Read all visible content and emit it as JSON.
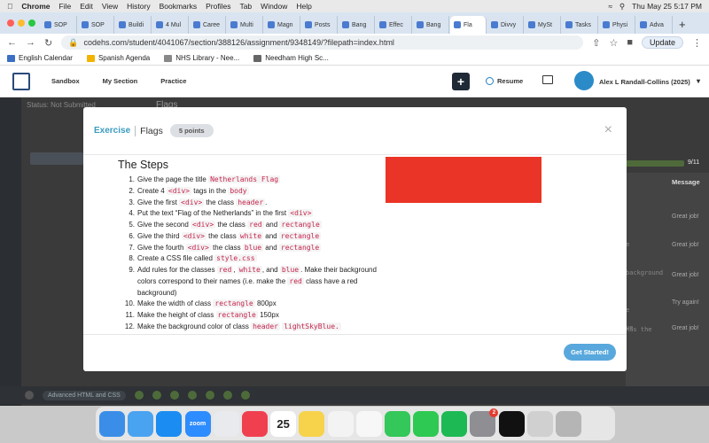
{
  "menubar": {
    "app": "Chrome",
    "items": [
      "File",
      "Edit",
      "View",
      "History",
      "Bookmarks",
      "Profiles",
      "Tab",
      "Window",
      "Help"
    ],
    "clock": "Thu May 25  5:17 PM"
  },
  "tabs": [
    "SOP",
    "SOP",
    "Buildi",
    "4 Mul",
    "Caree",
    "Multi",
    "Magn",
    "Posts",
    "Bang",
    "Effec",
    "Bang",
    "Fla",
    "Divvy",
    "MySt",
    "Tasks",
    "Physi",
    "Adva"
  ],
  "toolbar": {
    "url": "codehs.com/student/4041067/section/388126/assignment/9348149/?filepath=index.html",
    "update_label": "Update"
  },
  "bookmarks": [
    {
      "label": "English Calendar",
      "color": "#3b6fc4"
    },
    {
      "label": "Spanish Agenda",
      "color": "#f2b400"
    },
    {
      "label": "NHS Library - Nee...",
      "color": "#888888"
    },
    {
      "label": "Needham High Sc...",
      "color": "#666666"
    }
  ],
  "appheader": {
    "nav": [
      "Sandbox",
      "My Section",
      "Practice"
    ],
    "plus": "+",
    "resume": "Resume",
    "user": "Alex L Randall-Collins (2025)"
  },
  "ide": {
    "status": "Status: Not Submitted",
    "tab_text": "Flags",
    "progress_count": "9/11",
    "message_header": "Message",
    "messages": [
      "Great job!",
      "Great job!",
      "Great job!",
      "Try again!",
      "Great job!"
    ],
    "fragments": [
      "e",
      "background",
      "e",
      "ue",
      "has the"
    ],
    "footer_label": "Advanced HTML and CSS"
  },
  "modal": {
    "breadcrumb_exercise": "Exercise",
    "title": "Flags",
    "points": "5 points",
    "close": "×",
    "steps_title": "The Steps",
    "steps": [
      {
        "n": "1.",
        "parts": [
          {
            "t": "Give the page the title "
          },
          {
            "c": "Netherlands Flag"
          }
        ]
      },
      {
        "n": "2.",
        "parts": [
          {
            "t": "Create 4 "
          },
          {
            "c": "<div>"
          },
          {
            "t": " tags in the "
          },
          {
            "c": "body"
          }
        ]
      },
      {
        "n": "3.",
        "parts": [
          {
            "t": "Give the first "
          },
          {
            "c": "<div>"
          },
          {
            "t": " the class "
          },
          {
            "c": "header"
          },
          {
            "t": "."
          }
        ]
      },
      {
        "n": "4.",
        "parts": [
          {
            "t": "Put the text “Flag of the Netherlands” in the first "
          },
          {
            "c": "<div>"
          }
        ]
      },
      {
        "n": "5.",
        "parts": [
          {
            "t": "Give the second "
          },
          {
            "c": "<div>"
          },
          {
            "t": " the class "
          },
          {
            "c": "red"
          },
          {
            "t": " and "
          },
          {
            "c": "rectangle"
          }
        ]
      },
      {
        "n": "6.",
        "parts": [
          {
            "t": "Give the third "
          },
          {
            "c": "<div>"
          },
          {
            "t": " the class "
          },
          {
            "c": "white"
          },
          {
            "t": " and "
          },
          {
            "c": "rectangle"
          }
        ]
      },
      {
        "n": "7.",
        "parts": [
          {
            "t": "Give the fourth "
          },
          {
            "c": "<div>"
          },
          {
            "t": " the class "
          },
          {
            "c": "blue"
          },
          {
            "t": " and "
          },
          {
            "c": "rectangle"
          }
        ]
      },
      {
        "n": "8.",
        "parts": [
          {
            "t": "Create a CSS file called "
          },
          {
            "c": "style.css"
          }
        ]
      },
      {
        "n": "9.",
        "parts": [
          {
            "t": "Add rules for the classes "
          },
          {
            "c": "red"
          },
          {
            "t": ", "
          },
          {
            "c": "white"
          },
          {
            "t": ", and "
          },
          {
            "c": "blue"
          },
          {
            "t": ". Make their background colors correspond to their names (i.e. make the "
          },
          {
            "c": "red"
          },
          {
            "t": " class have a red background)"
          }
        ]
      },
      {
        "n": "10.",
        "parts": [
          {
            "t": "Make the width of class "
          },
          {
            "c": "rectangle"
          },
          {
            "t": " 800px"
          }
        ]
      },
      {
        "n": "11.",
        "parts": [
          {
            "t": "Make the height of class "
          },
          {
            "c": "rectangle"
          },
          {
            "t": " 150px"
          }
        ]
      },
      {
        "n": "12.",
        "parts": [
          {
            "t": "Make the background color of class "
          },
          {
            "c": "header"
          },
          {
            "t": " "
          },
          {
            "c": "lightSkyBlue."
          }
        ]
      }
    ],
    "preview_color": "#ea3427",
    "cta": "Get Started!"
  },
  "dock": [
    {
      "icon": "finder-icon",
      "color": "#3b8ee8"
    },
    {
      "icon": "mail-icon",
      "color": "#4aa3f0"
    },
    {
      "icon": "app-store-icon",
      "color": "#1b8cf2"
    },
    {
      "icon": "zoom-icon",
      "color": "#2d8cff",
      "label": "zoom"
    },
    {
      "icon": "chrome-icon",
      "color": "#e8eaed"
    },
    {
      "icon": "music-icon",
      "color": "#f0404f"
    },
    {
      "icon": "calendar-icon",
      "color": "#ffffff",
      "label": "25"
    },
    {
      "icon": "notes-icon",
      "color": "#f7d24b"
    },
    {
      "icon": "photos-icon",
      "color": "#f3f3f3"
    },
    {
      "icon": "reminders-icon",
      "color": "#f7f7f7"
    },
    {
      "icon": "messages-icon",
      "color": "#34c759"
    },
    {
      "icon": "facetime-icon",
      "color": "#2ec952"
    },
    {
      "icon": "spotify-icon",
      "color": "#1db954"
    },
    {
      "icon": "settings-icon",
      "color": "#8e8e93",
      "badge": "2"
    },
    {
      "icon": "apple-tv-icon",
      "color": "#111111"
    },
    {
      "icon": "launchpad-icon",
      "color": "#d0d0d0"
    },
    {
      "icon": "trash-icon",
      "color": "#b5b5b5"
    }
  ]
}
